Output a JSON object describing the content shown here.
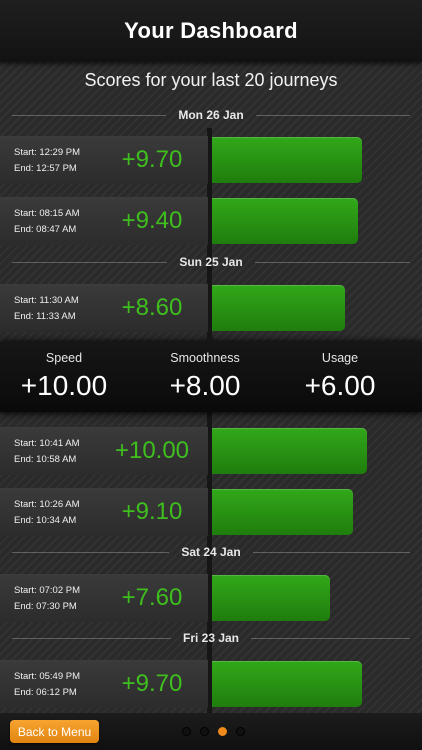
{
  "header": {
    "title": "Your Dashboard"
  },
  "subtitle": "Scores for your last 20 journeys",
  "groups": [
    {
      "date": "Mon 26 Jan",
      "journeys": [
        {
          "start": "Start: 12:29 PM",
          "end": "End: 12:57 PM",
          "score": "+9.70",
          "value": 9.7
        },
        {
          "start": "Start: 08:15 AM",
          "end": "End: 08:47 AM",
          "score": "+9.40",
          "value": 9.4
        }
      ]
    },
    {
      "date": "Sun 25 Jan",
      "journeys": [
        {
          "start": "Start: 11:30 AM",
          "end": "End: 11:33 AM",
          "score": "+8.60",
          "value": 8.6
        }
      ]
    },
    {
      "date": "",
      "journeys": [
        {
          "start": "Start: 10:41 AM",
          "end": "End: 10:58 AM",
          "score": "+10.00",
          "value": 10.0
        },
        {
          "start": "Start: 10:26 AM",
          "end": "End: 10:34 AM",
          "score": "+9.10",
          "value": 9.1
        }
      ]
    },
    {
      "date": "Sat 24 Jan",
      "journeys": [
        {
          "start": "Start: 07:02 PM",
          "end": "End: 07:30 PM",
          "score": "+7.60",
          "value": 7.6
        }
      ]
    },
    {
      "date": "Fri 23 Jan",
      "journeys": [
        {
          "start": "Start: 05:49 PM",
          "end": "End: 06:12 PM",
          "score": "+9.70",
          "value": 9.7
        }
      ]
    }
  ],
  "stats": [
    {
      "label": "Speed",
      "value": "+10.00"
    },
    {
      "label": "Smoothness",
      "value": "+8.00"
    },
    {
      "label": "Usage",
      "value": "+6.00"
    }
  ],
  "footer": {
    "back_label": "Back to Menu",
    "page_count": 4,
    "active_page": 3
  },
  "colors": {
    "score_text": "#3fbf1e",
    "bar": "#2a9a16",
    "accent": "#f08a1c"
  },
  "icons": [
    "page-indicator-dot-icon"
  ]
}
